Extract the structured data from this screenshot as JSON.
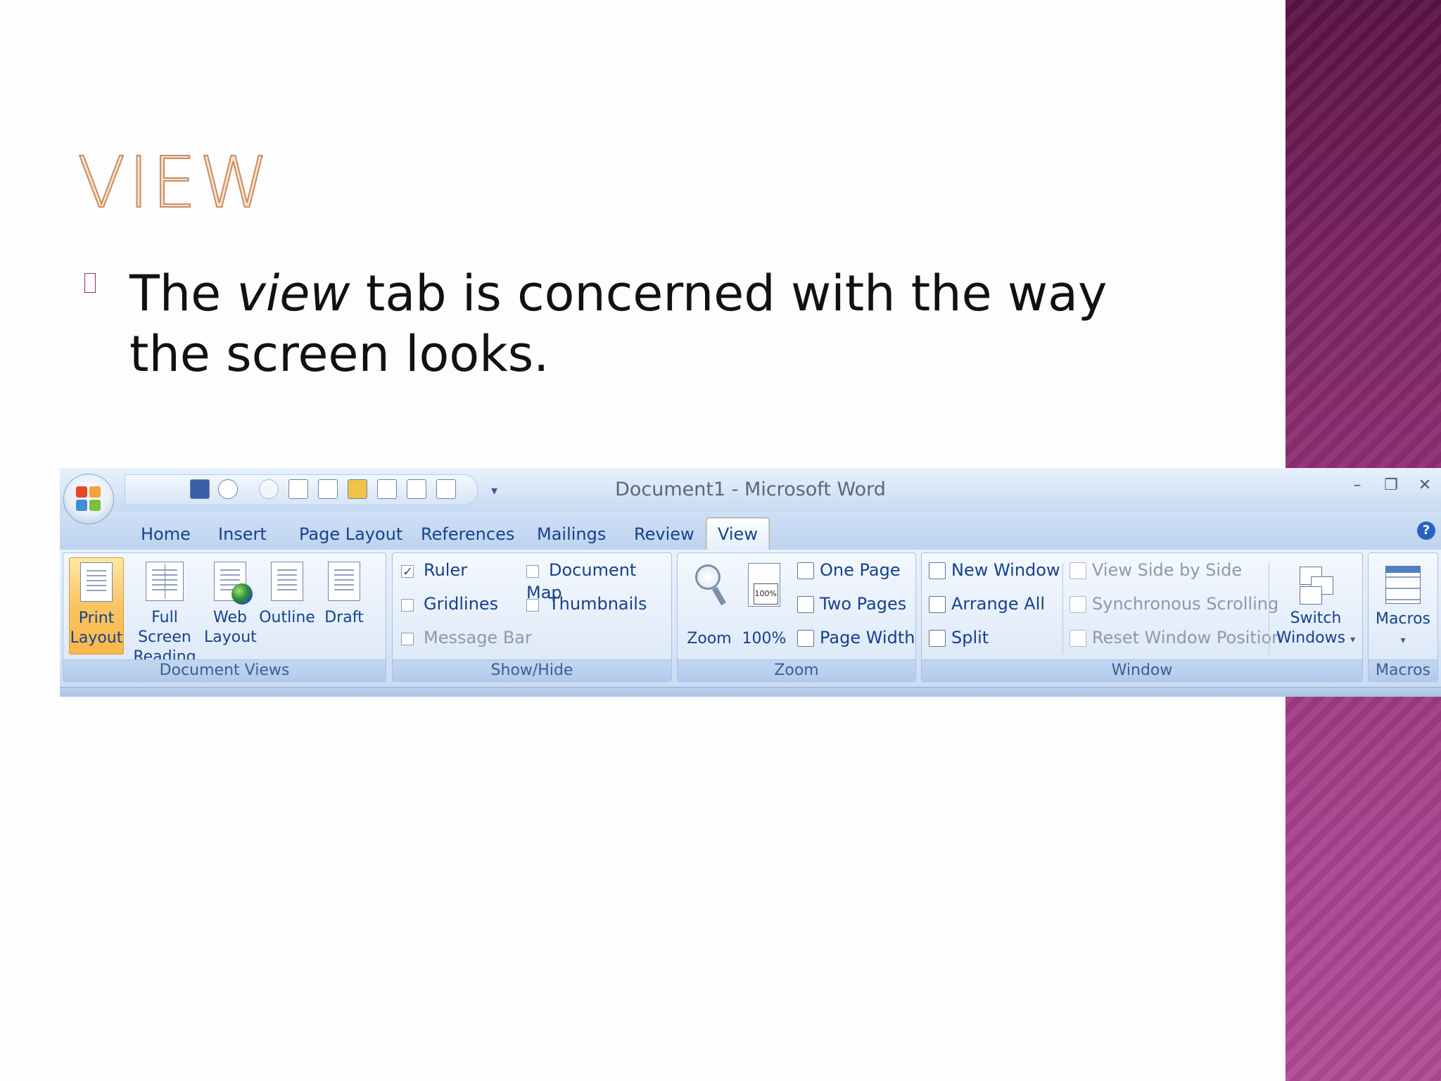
{
  "slide": {
    "title": "VIEW",
    "bullet_before": "The ",
    "bullet_em": "view",
    "bullet_after": " tab is concerned with the way the screen looks."
  },
  "word": {
    "window_title": "Document1 - Microsoft Word",
    "quick_access_icons": [
      "save-icon",
      "undo-icon",
      "redo-icon",
      "print-icon",
      "new-document-icon",
      "open-folder-icon",
      "attach-icon",
      "print-preview-icon",
      "spelling-icon"
    ],
    "tabs": [
      "Home",
      "Insert",
      "Page Layout",
      "References",
      "Mailings",
      "Review",
      "View"
    ],
    "active_tab": "View",
    "groups": {
      "document_views": {
        "label": "Document Views",
        "buttons": [
          {
            "line1": "Print",
            "line2": "Layout"
          },
          {
            "line1": "Full Screen",
            "line2": "Reading"
          },
          {
            "line1": "Web",
            "line2": "Layout"
          },
          {
            "line1": "Outline",
            "line2": ""
          },
          {
            "line1": "Draft",
            "line2": ""
          }
        ]
      },
      "show_hide": {
        "label": "Show/Hide",
        "ruler": "Ruler",
        "ruler_checked": true,
        "gridlines": "Gridlines",
        "message_bar": "Message Bar",
        "document_map": "Document Map",
        "thumbnails": "Thumbnails"
      },
      "zoom": {
        "label": "Zoom",
        "zoom": "Zoom",
        "hundred": "100%",
        "one_page": "One Page",
        "two_pages": "Two Pages",
        "page_width": "Page Width"
      },
      "window": {
        "label": "Window",
        "new_window": "New Window",
        "arrange_all": "Arrange All",
        "split": "Split",
        "view_side_by_side": "View Side by Side",
        "synchronous_scrolling": "Synchronous Scrolling",
        "reset_window_position": "Reset Window Position",
        "switch_line1": "Switch",
        "switch_line2": "Windows"
      },
      "macros": {
        "label": "Macros",
        "button": "Macros"
      }
    }
  },
  "colors": {
    "title_fill": "#fbe2b8",
    "title_stroke": "#c88c70",
    "ribbon_text": "#15428b",
    "side_band": "#8f2f78"
  }
}
